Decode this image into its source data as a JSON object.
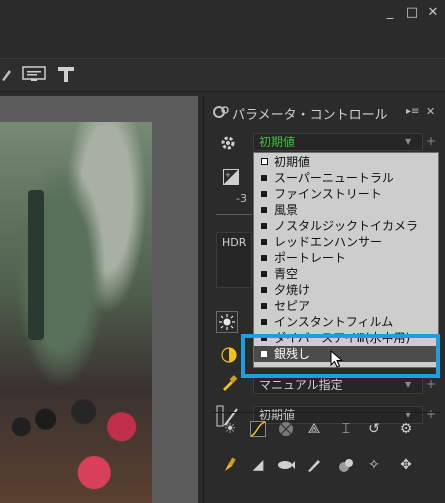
{
  "window": {
    "minimize": "_",
    "maximize": "□",
    "close": "✕"
  },
  "panel": {
    "title": "パラメータ・コントロール",
    "hdr_label": "HDR",
    "exposure_value": "-3"
  },
  "picture_control": {
    "current": "初期値",
    "options": [
      "初期値",
      "スーパーニュートラル",
      "ファインストリート",
      "風景",
      "ノスタルジックトイカメラ",
      "レッドエンハンサー",
      "ポートレート",
      "青空",
      "夕焼け",
      "セピア",
      "インスタントフィルム",
      "ダイバースアイⅢ(水中用)",
      "銀残し"
    ],
    "selected": "銀残し"
  },
  "white_balance": {
    "value": "マニュアル指定"
  },
  "tone": {
    "value": "初期値"
  },
  "colors": {
    "accent_highlight": "#1e9ee0",
    "green_text": "#3fbf3f",
    "selected_row": "#4c4c4c"
  }
}
